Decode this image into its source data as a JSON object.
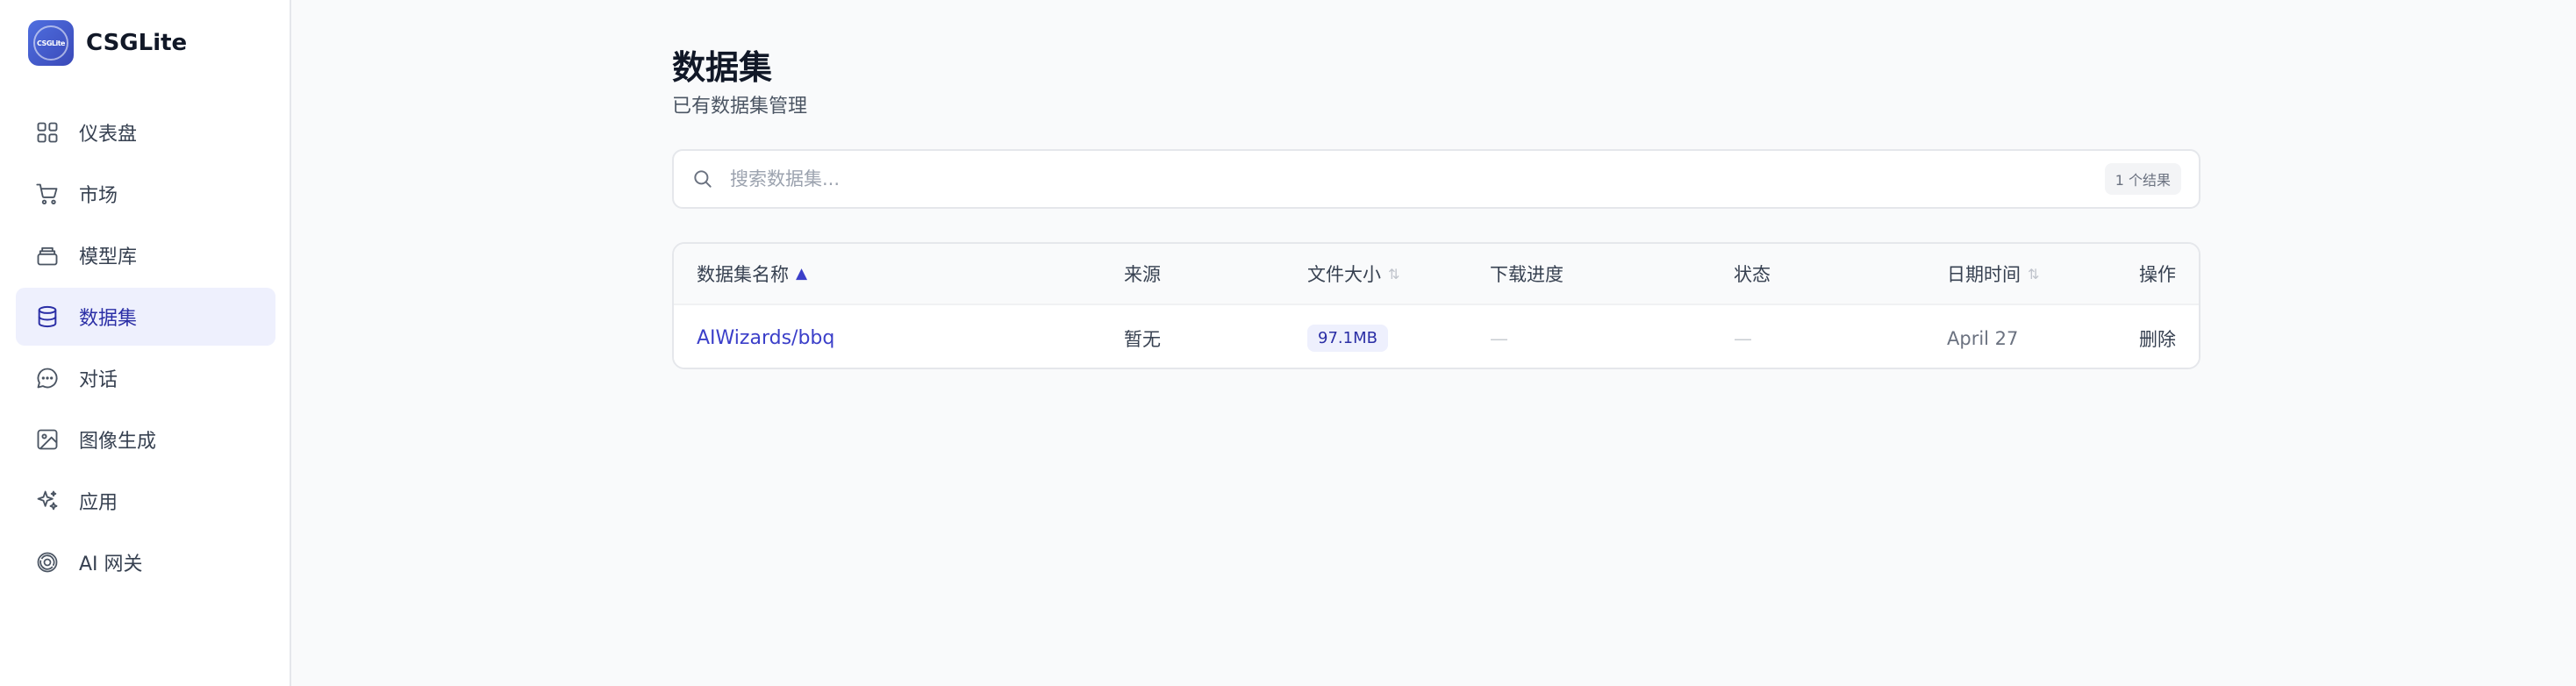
{
  "app": {
    "name": "CSGLite",
    "logo_text": "CSGLite"
  },
  "sidebar": {
    "items": [
      {
        "label": "仪表盘",
        "icon": "grid-icon",
        "active": false
      },
      {
        "label": "市场",
        "icon": "cart-icon",
        "active": false
      },
      {
        "label": "模型库",
        "icon": "layers-icon",
        "active": false
      },
      {
        "label": "数据集",
        "icon": "database-icon",
        "active": true
      },
      {
        "label": "对话",
        "icon": "chat-icon",
        "active": false
      },
      {
        "label": "图像生成",
        "icon": "image-icon",
        "active": false
      },
      {
        "label": "应用",
        "icon": "sparkles-icon",
        "active": false
      },
      {
        "label": "AI 网关",
        "icon": "gateway-icon",
        "active": false
      }
    ]
  },
  "header": {
    "title": "数据集",
    "subtitle": "已有数据集管理"
  },
  "search": {
    "placeholder": "搜索数据集...",
    "value": "",
    "result_count": "1 个结果"
  },
  "table": {
    "columns": {
      "name": "数据集名称",
      "source": "来源",
      "size": "文件大小",
      "progress": "下载进度",
      "status": "状态",
      "date": "日期时间",
      "actions": "操作"
    },
    "sort": {
      "column": "name",
      "direction": "asc",
      "indicator": "▲",
      "inactive_indicator": "⇅"
    },
    "rows": [
      {
        "name": "AIWizards/bbq",
        "source": "暂无",
        "size": "97.1MB",
        "progress": "—",
        "status": "—",
        "date": "April 27",
        "action": "删除"
      }
    ]
  },
  "colors": {
    "accent": "#3b3fc9",
    "active_bg": "#eef0fd",
    "background": "#f9fafb",
    "border": "#e5e7eb"
  }
}
